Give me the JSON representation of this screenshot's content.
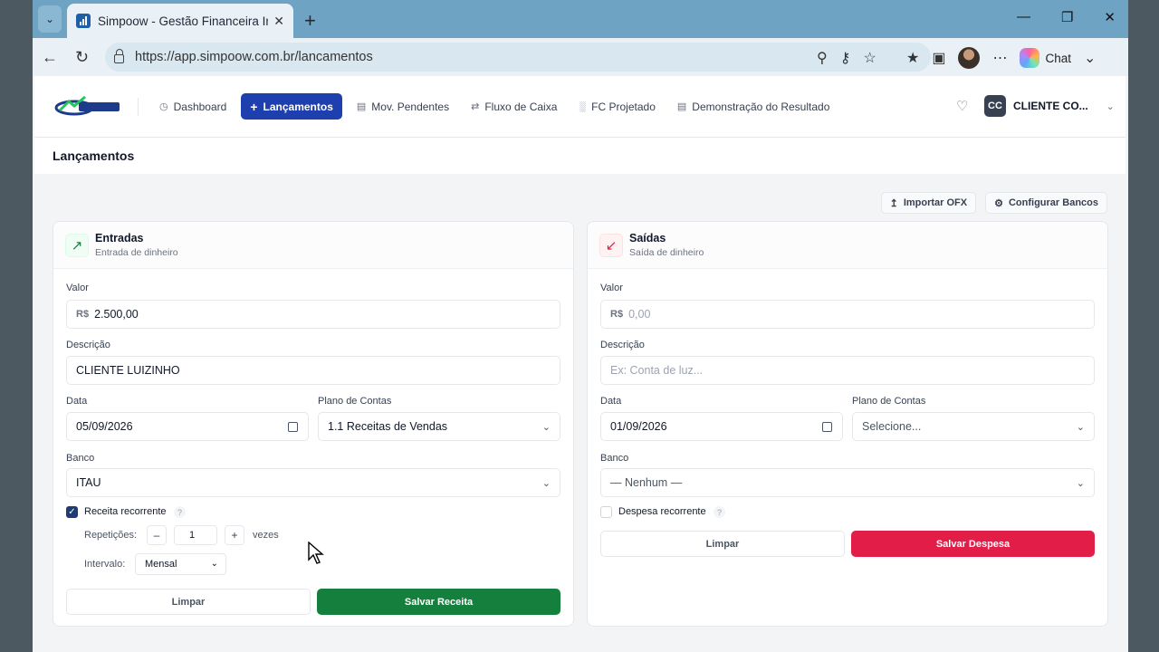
{
  "browser": {
    "tab_title": "Simpoow - Gestão Financeira Intel",
    "url": "https://app.simpoow.com.br/lancamentos",
    "chat_label": "Chat"
  },
  "nav": {
    "items": [
      {
        "label": "Dashboard",
        "icon": "dashboard-icon"
      },
      {
        "label": "Lançamentos",
        "icon": "plus-icon",
        "active": true
      },
      {
        "label": "Mov. Pendentes",
        "icon": "calendar-icon"
      },
      {
        "label": "Fluxo de Caixa",
        "icon": "arrows-icon"
      },
      {
        "label": "FC Projetado",
        "icon": "bar-chart-icon"
      },
      {
        "label": "Demonstração do Resultado",
        "icon": "document-icon"
      }
    ],
    "user_initials": "CC",
    "user_name": "CLIENTE CO..."
  },
  "page": {
    "title": "Lançamentos",
    "import_label": "Importar OFX",
    "config_label": "Configurar Bancos"
  },
  "entradas": {
    "title": "Entradas",
    "subtitle": "Entrada de dinheiro",
    "valor_label": "Valor",
    "currency": "R$",
    "valor": "2.500,00",
    "descricao_label": "Descrição",
    "descricao": "CLIENTE LUIZINHO",
    "data_label": "Data",
    "data": "05/09/2026",
    "plano_label": "Plano de Contas",
    "plano": "1.1 Receitas de Vendas",
    "banco_label": "Banco",
    "banco": "ITAU",
    "recorrente_label": "Receita recorrente",
    "recorrente": true,
    "repeticoes_label": "Repetições:",
    "repeticoes": "1",
    "vezes_label": "vezes",
    "intervalo_label": "Intervalo:",
    "intervalo": "Mensal",
    "limpar_label": "Limpar",
    "salvar_label": "Salvar Receita"
  },
  "saidas": {
    "title": "Saídas",
    "subtitle": "Saída de dinheiro",
    "valor_label": "Valor",
    "currency": "R$",
    "valor_placeholder": "0,00",
    "descricao_label": "Descrição",
    "descricao_placeholder": "Ex: Conta de luz...",
    "data_label": "Data",
    "data": "01/09/2026",
    "plano_label": "Plano de Contas",
    "plano_placeholder": "Selecione...",
    "banco_label": "Banco",
    "banco": "— Nenhum —",
    "recorrente_label": "Despesa recorrente",
    "recorrente": false,
    "limpar_label": "Limpar",
    "salvar_label": "Salvar Despesa"
  },
  "colors": {
    "primary": "#1e40af",
    "success": "#15803d",
    "danger": "#e11d48"
  }
}
